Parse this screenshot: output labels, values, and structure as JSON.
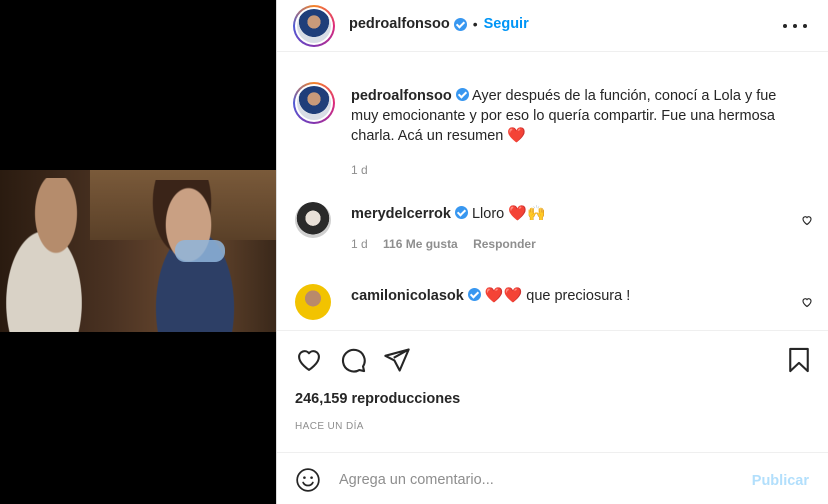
{
  "post": {
    "author": "pedroalfonsoo",
    "follow_label": "Seguir",
    "separator": "•",
    "caption": "Ayer después de la función, conocí a Lola y fue muy emocionante y por eso lo quería compartir. Fue una hermosa charla. Acá un resumen",
    "caption_emoji": "❤️",
    "caption_time": "1 d"
  },
  "comments": [
    {
      "user": "merydelcerrok",
      "text": "Lloro",
      "emoji": "❤️🙌",
      "time": "1 d",
      "likes": "116 Me gusta",
      "reply_label": "Responder"
    },
    {
      "user": "camilonicolasok",
      "emoji_lead": "❤️❤️",
      "text": "que preciosura !"
    }
  ],
  "stats": {
    "views": "246,159 reproducciones",
    "timestamp": "HACE UN DÍA"
  },
  "composer": {
    "placeholder": "Agrega un comentario...",
    "post_label": "Publicar"
  },
  "icons": {
    "like": "heart-icon",
    "comment": "comment-icon",
    "share": "share-icon",
    "save": "bookmark-icon",
    "emoji": "emoji-icon",
    "more": "more-icon"
  },
  "colors": {
    "accent": "#0095f6",
    "heart": "#e0245e",
    "muted": "#8e8e8e"
  }
}
